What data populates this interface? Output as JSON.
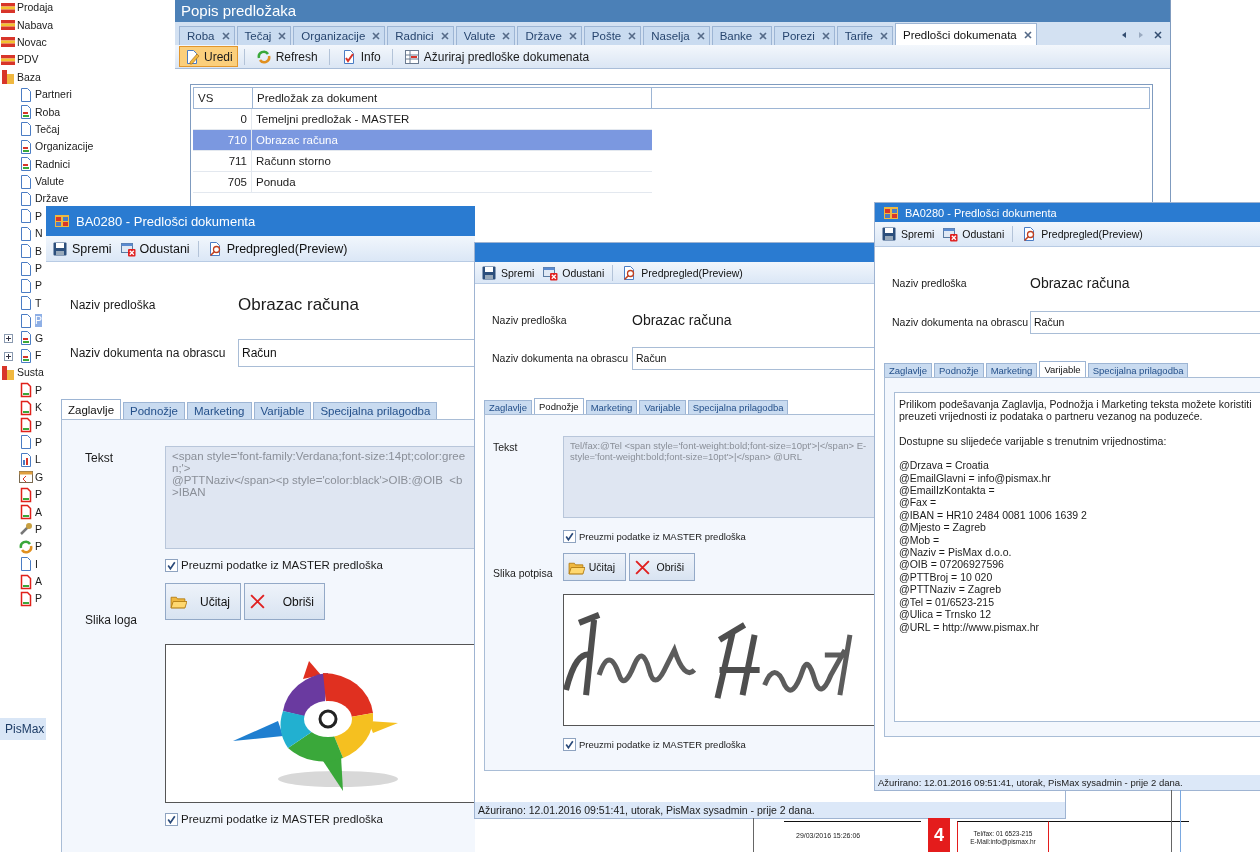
{
  "sidebar": {
    "items": [
      {
        "label": "Prodaja",
        "kind": "module",
        "selected": false
      },
      {
        "label": "Nabava",
        "kind": "module",
        "selected": false
      },
      {
        "label": "Novac",
        "kind": "module",
        "selected": false
      },
      {
        "label": "PDV",
        "kind": "module",
        "selected": false
      },
      {
        "label": "Baza",
        "kind": "folder",
        "selected": false,
        "children": [
          {
            "label": "Partneri",
            "kind": "page",
            "selected": false
          },
          {
            "label": "Roba",
            "kind": "report",
            "selected": false
          },
          {
            "label": "Tečaj",
            "kind": "page",
            "selected": false
          },
          {
            "label": "Organizacije",
            "kind": "report",
            "selected": false
          },
          {
            "label": "Radnici",
            "kind": "report",
            "selected": false
          },
          {
            "label": "Valute",
            "kind": "page",
            "selected": false
          },
          {
            "label": "Države",
            "kind": "page",
            "selected": false
          },
          {
            "label": "P",
            "kind": "page",
            "selected": false
          },
          {
            "label": "N",
            "kind": "page",
            "selected": false
          },
          {
            "label": "B",
            "kind": "page",
            "selected": false
          },
          {
            "label": "P",
            "kind": "page",
            "selected": false
          },
          {
            "label": "P",
            "kind": "page",
            "selected": false
          },
          {
            "label": "T",
            "kind": "page",
            "selected": false
          },
          {
            "label": "P",
            "kind": "page",
            "selected": true
          },
          {
            "label": "G",
            "kind": "report",
            "selected": false,
            "expanded": false
          },
          {
            "label": "F",
            "kind": "report",
            "selected": false,
            "expanded": false
          }
        ]
      },
      {
        "label": "Susta",
        "kind": "folder",
        "selected": false,
        "children": [
          {
            "label": "P",
            "kind": "redpage",
            "selected": false
          },
          {
            "label": "K",
            "kind": "redpage",
            "selected": false
          },
          {
            "label": "P",
            "kind": "redpage",
            "selected": false
          },
          {
            "label": "P",
            "kind": "page",
            "selected": false
          },
          {
            "label": "L",
            "kind": "chart",
            "selected": false
          },
          {
            "label": "G",
            "kind": "table",
            "selected": false
          },
          {
            "label": "P",
            "kind": "redpage",
            "selected": false
          },
          {
            "label": "A",
            "kind": "redpage",
            "selected": false
          },
          {
            "label": "P",
            "kind": "tools",
            "selected": false
          },
          {
            "label": "P",
            "kind": "refresh",
            "selected": false
          },
          {
            "label": "I",
            "kind": "page",
            "selected": false
          },
          {
            "label": "A",
            "kind": "redpage",
            "selected": false
          },
          {
            "label": "P",
            "kind": "redpage",
            "selected": false
          }
        ]
      }
    ],
    "footer": "PisMax"
  },
  "list_window": {
    "title": "Popis predložaka",
    "tabs": [
      {
        "label": "Roba",
        "selected": false
      },
      {
        "label": "Tečaj",
        "selected": false
      },
      {
        "label": "Organizacije",
        "selected": false
      },
      {
        "label": "Radnici",
        "selected": false
      },
      {
        "label": "Valute",
        "selected": false
      },
      {
        "label": "Države",
        "selected": false
      },
      {
        "label": "Pošte",
        "selected": false
      },
      {
        "label": "Naselja",
        "selected": false
      },
      {
        "label": "Banke",
        "selected": false
      },
      {
        "label": "Porezi",
        "selected": false
      },
      {
        "label": "Tarife",
        "selected": false
      },
      {
        "label": "Predlošci dokumenata",
        "selected": true
      }
    ],
    "toolbar": [
      {
        "label": "Uredi",
        "kind": "edit",
        "selected": true
      },
      {
        "label": "Refresh",
        "kind": "refresh",
        "selected": false
      },
      {
        "label": "Info",
        "kind": "info",
        "selected": false
      },
      {
        "label": "Ažuriraj predloške dokumenata",
        "kind": "update",
        "selected": false
      }
    ],
    "table": {
      "columns": [
        "VS",
        "Predložak za dokument"
      ],
      "rows": [
        {
          "cells": [
            "0",
            "Temeljni predložak - MASTER"
          ],
          "selected": false
        },
        {
          "cells": [
            "710",
            "Obrazac računa"
          ],
          "selected": true
        },
        {
          "cells": [
            "711",
            "Računn storno"
          ],
          "selected": false
        },
        {
          "cells": [
            "705",
            "Ponuda"
          ],
          "selected": false
        }
      ]
    }
  },
  "editors": [
    {
      "title": "BA0280 - Predlošci dokumenta",
      "toolbar": [
        {
          "label": "Spremi",
          "kind": "save"
        },
        {
          "label": "Odustani",
          "kind": "cancel"
        },
        {
          "label": "Predpregled(Preview)",
          "kind": "preview"
        }
      ],
      "name_label": "Naziv predloška",
      "name": "Obrazac računa",
      "doc_label": "Naziv dokumenta na obrascu",
      "doc_value": "Račun",
      "tabs": [
        {
          "label": "Zaglavlje",
          "selected": true
        },
        {
          "label": "Podnožje",
          "selected": false
        },
        {
          "label": "Marketing",
          "selected": false
        },
        {
          "label": "Varijable",
          "selected": false
        },
        {
          "label": "Specijalna prilagodba",
          "selected": false
        }
      ],
      "panel": {
        "kind": "text_image",
        "text_label": "Tekst",
        "text": "<span style='font-family:Verdana;font-size:14pt;color:green;'>\n@PTTNaziv</span><p style='color:black'>OIB:@OIB  <b>IBAN",
        "text_master": {
          "label": "Preuzmi podatke iz MASTER predloška",
          "checked": true
        },
        "image_label": "Slika loga",
        "buttons": [
          {
            "label": "Učitaj",
            "kind": "load"
          },
          {
            "label": "Obriši",
            "kind": "delete"
          }
        ],
        "image_master": {
          "label": "Preuzmi podatke iz MASTER predloška",
          "checked": true
        }
      }
    },
    {
      "toolbar": [
        {
          "label": "Spremi",
          "kind": "save"
        },
        {
          "label": "Odustani",
          "kind": "cancel"
        },
        {
          "label": "Predpregled(Preview)",
          "kind": "preview"
        }
      ],
      "name_label": "Naziv predloška",
      "name": "Obrazac računa",
      "doc_label": "Naziv dokumenta na obrascu",
      "doc_value": "Račun",
      "tabs": [
        {
          "label": "Zaglavlje",
          "selected": false
        },
        {
          "label": "Podnožje",
          "selected": true
        },
        {
          "label": "Marketing",
          "selected": false
        },
        {
          "label": "Varijable",
          "selected": false
        },
        {
          "label": "Specijalna prilagodba",
          "selected": false
        }
      ],
      "panel": {
        "kind": "text_image",
        "text_label": "Tekst",
        "text": "Tel/fax:@Tel <span style='font-weight:bold;font-size=10pt'>|</span> E-\nstyle='font-weight:bold;font-size=10pt'>|</span> @URL",
        "text_master": {
          "label": "Preuzmi podatke iz MASTER predloška",
          "checked": true
        },
        "image_label": "Slika potpisa",
        "buttons": [
          {
            "label": "Učitaj",
            "kind": "load"
          },
          {
            "label": "Obriši",
            "kind": "delete"
          }
        ],
        "image_master": {
          "label": "Preuzmi podatke iz MASTER predloška",
          "checked": true
        }
      },
      "status": "Ažurirano: 12.01.2016 09:51:41, utorak, PisMax sysadmin -  prije 2 dana."
    },
    {
      "title": "BA0280 - Predlošci dokumenta",
      "toolbar": [
        {
          "label": "Spremi",
          "kind": "save"
        },
        {
          "label": "Odustani",
          "kind": "cancel"
        },
        {
          "label": "Predpregled(Preview)",
          "kind": "preview"
        }
      ],
      "name_label": "Naziv predloška",
      "name": "Obrazac računa",
      "doc_label": "Naziv dokumenta na obrascu",
      "doc_value": "Račun",
      "tabs": [
        {
          "label": "Zaglavlje",
          "selected": false
        },
        {
          "label": "Podnožje",
          "selected": false
        },
        {
          "label": "Marketing",
          "selected": false
        },
        {
          "label": "Varijable",
          "selected": true
        },
        {
          "label": "Specijalna prilagodba",
          "selected": false
        }
      ],
      "panel": {
        "kind": "variables",
        "intro": [
          "Prilikom podešavanja Zaglavlja, Podnožja i Marketing teksta možete koristiti",
          "preuzeti vrijednosti iz podataka o partneru vezanog na poduzeće."
        ],
        "available": "Dostupne su slijedeće varijable s trenutnim vrijednostima:",
        "variables": [
          "@Drzava = Croatia",
          "@EmailGlavni = info@pismax.hr",
          "@EmailIzKontakta =",
          "@Fax =",
          "@IBAN = HR10 2484 0081 1006 1639 2",
          "@Mjesto = Zagreb",
          "@Mob =",
          "@Naziv = PisMax d.o.o.",
          "@OIB = 07206927596",
          "@PTTBroj = 10 020",
          "@PTTNaziv = Zagreb",
          "@Tel = 01/6523-215",
          "@Ulica = Trnsko 12",
          "@URL = http://www.pismax.hr"
        ]
      },
      "status": "Ažurirano: 12.01.2016 09:51:41, utorak, PisMax sysadmin -  prije 2 dana."
    }
  ],
  "print_preview": {
    "date": "29/03/2016 15:26:06",
    "page_number": "4",
    "footer_lines": [
      "Tel/fax: 01 6523-215",
      "E-Mail:info@pismax.hr"
    ]
  }
}
